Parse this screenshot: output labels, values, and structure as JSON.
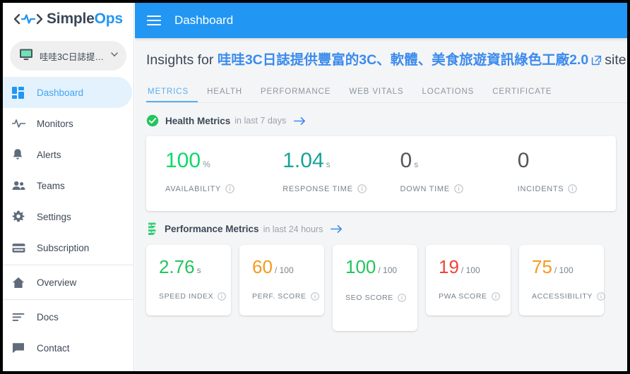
{
  "brand": {
    "name_part1": "Simple",
    "name_part2": "Ops",
    "logo_icon": "activity-pulse-logo"
  },
  "sidebar": {
    "site_selector": {
      "label": "哇哇3C日誌提…",
      "monitor_icon": "desktop-monitor-icon",
      "caret_icon": "chevron-down-icon"
    },
    "items": [
      {
        "label": "Dashboard",
        "icon": "dashboard-grid-icon",
        "active": true
      },
      {
        "label": "Monitors",
        "icon": "activity-pulse-icon",
        "active": false
      },
      {
        "label": "Alerts",
        "icon": "bell-icon",
        "active": false
      },
      {
        "label": "Teams",
        "icon": "people-icon",
        "active": false
      },
      {
        "label": "Settings",
        "icon": "gear-icon",
        "active": false
      },
      {
        "label": "Subscription",
        "icon": "credit-card-icon",
        "active": false
      },
      {
        "label": "Overview",
        "icon": "home-icon",
        "active": false
      },
      {
        "label": "Docs",
        "icon": "document-lines-icon",
        "active": false
      },
      {
        "label": "Contact",
        "icon": "chat-bubble-icon",
        "active": false
      }
    ]
  },
  "topbar": {
    "menu_icon": "hamburger-menu-icon",
    "title": "Dashboard"
  },
  "page": {
    "title_prefix": "Insights for",
    "site_name": "哇哇3C日誌提供豐富的3C、軟體、美食旅遊資訊綠色工廠2.0",
    "external_link_icon": "external-link-icon",
    "title_suffix": "site"
  },
  "tabs": [
    {
      "label": "METRICS",
      "active": true
    },
    {
      "label": "HEALTH",
      "active": false
    },
    {
      "label": "PERFORMANCE",
      "active": false
    },
    {
      "label": "WEB VITALS",
      "active": false
    },
    {
      "label": "LOCATIONS",
      "active": false
    },
    {
      "label": "CERTIFICATE",
      "active": false
    }
  ],
  "health_section": {
    "icon": "green-check-circle-icon",
    "title": "Health Metrics",
    "subtitle": "in last 7 days",
    "arrow_icon": "arrow-right-icon",
    "metrics": [
      {
        "value": "100",
        "unit": "%",
        "label": "AVAILABILITY",
        "color": "#0ed96b",
        "info_icon": "info-icon"
      },
      {
        "value": "1.04",
        "unit": "s",
        "label": "RESPONSE TIME",
        "color": "#17a398",
        "info_icon": "info-icon"
      },
      {
        "value": "0",
        "unit": "s",
        "label": "DOWN TIME",
        "color": "#53565a",
        "info_icon": "info-icon"
      },
      {
        "value": "0",
        "unit": "",
        "label": "INCIDENTS",
        "color": "#53565a",
        "info_icon": "info-icon"
      }
    ]
  },
  "performance_section": {
    "icon": "green-speed-icon",
    "title": "Performance Metrics",
    "subtitle": "in last 24 hours",
    "arrow_icon": "arrow-right-icon",
    "metrics": [
      {
        "value": "2.76",
        "denom": "s",
        "label": "SPEED INDEX",
        "color": "#22c55e",
        "info_icon": "info-icon"
      },
      {
        "value": "60",
        "denom": "/ 100",
        "label": "PERF. SCORE",
        "color": "#f59a1e",
        "info_icon": "info-icon"
      },
      {
        "value": "100",
        "denom": "/ 100",
        "label": "SEO SCORE",
        "color": "#22c55e",
        "info_icon": "info-icon"
      },
      {
        "value": "19",
        "denom": "/ 100",
        "label": "PWA SCORE",
        "color": "#f04438",
        "info_icon": "info-icon"
      },
      {
        "value": "75",
        "denom": "/ 100",
        "label": "ACCESSIBILITY",
        "color": "#f59a1e",
        "info_icon": "info-icon"
      }
    ]
  },
  "colors": {
    "accent_blue": "#2196f3",
    "active_nav_bg": "#e3f2fd",
    "page_bg": "#f4f5f6",
    "card_bg": "#ffffff",
    "text_primary": "#3c4858",
    "text_muted": "#8c97a3"
  }
}
